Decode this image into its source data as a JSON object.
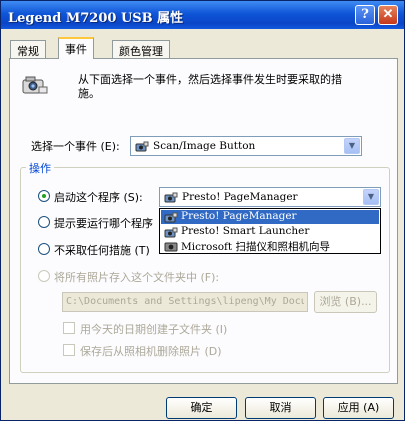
{
  "window": {
    "title": "Legend M7200 USB 属性",
    "help": "?",
    "close": "✕"
  },
  "tabs": [
    {
      "label": "常规"
    },
    {
      "label": "事件"
    },
    {
      "label": "颜色管理"
    }
  ],
  "description": {
    "line1": "从下面选择一个事件，然后选择事件发生时要采取的措",
    "line2": "施。"
  },
  "event": {
    "label": "选择一个事件 (E):",
    "value": "Scan/Image Button"
  },
  "actions": {
    "group_label": "操作",
    "start_program": {
      "label": "启动这个程序 (S):",
      "checked": true
    },
    "selected_program": "Presto! PageManager",
    "program_options": [
      "Presto! PageManager",
      "Presto! Smart Launcher",
      "Microsoft 扫描仪和照相机向导"
    ],
    "prompt_program": {
      "label": "提示要运行哪个程序"
    },
    "no_action": {
      "label": "不采取任何措施 (T)"
    },
    "save_all": {
      "label": "将所有照片存入这个文件夹中 (F):"
    },
    "folder_path": "C:\\Documents and Settings\\lipeng\\My Docum",
    "browse": "浏览 (B)...",
    "date_subfolder": "用今天的日期创建子文件夹 (I)",
    "delete_after": "保存后从照相机删除照片 (D)"
  },
  "footer": {
    "ok": "确定",
    "cancel": "取消",
    "apply": "应用 (A)"
  }
}
